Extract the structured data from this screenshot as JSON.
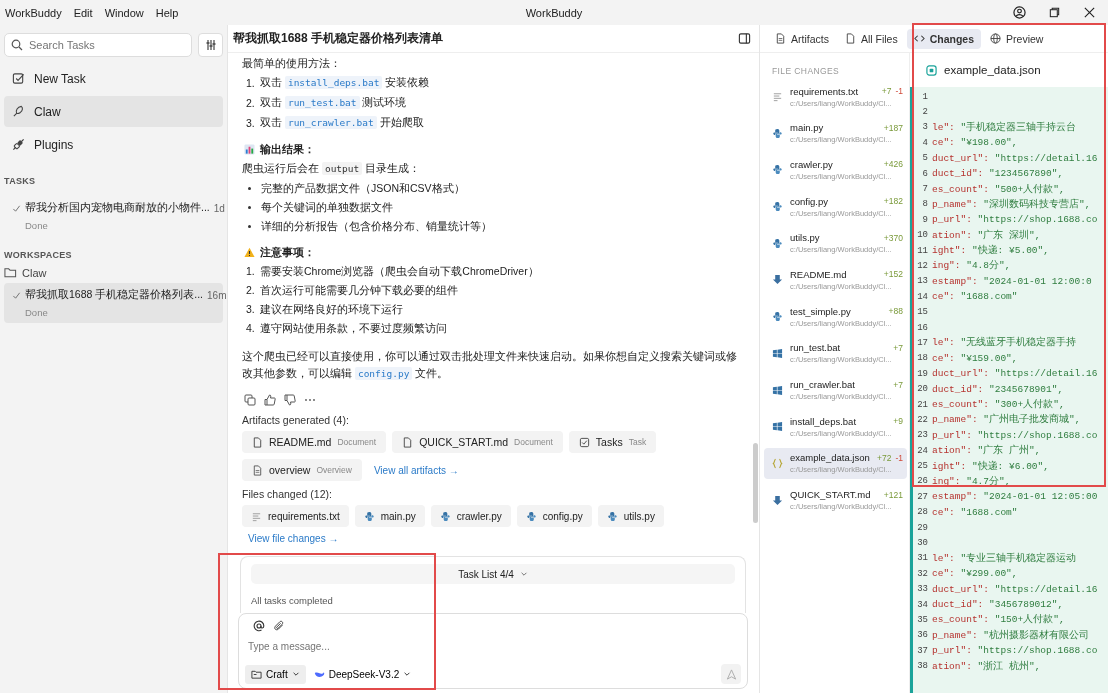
{
  "window": {
    "title": "WorkBuddy",
    "menu": [
      "WorkBuddy",
      "Edit",
      "Window",
      "Help"
    ]
  },
  "sidebar": {
    "search": {
      "placeholder": "Search Tasks"
    },
    "nav": [
      {
        "label": "New Task",
        "kind": "new",
        "selected": false
      },
      {
        "label": "Claw",
        "kind": "claw",
        "selected": true
      },
      {
        "label": "Plugins",
        "kind": "plugins",
        "selected": false
      }
    ],
    "tasks_heading": "TASKS",
    "tasks": [
      {
        "title": "帮我分析国内宠物电商耐放的小物件...",
        "time": "1d",
        "status": "Done",
        "selected": false
      }
    ],
    "workspaces_heading": "WORKSPACES",
    "workspace": {
      "name": "Claw",
      "tasks": [
        {
          "title": "帮我抓取1688 手机稳定器价格列表...",
          "time": "16m",
          "status": "Done",
          "selected": true
        }
      ]
    }
  },
  "chat": {
    "title": "帮我抓取1688 手机稳定器价格列表清单",
    "usage": {
      "intro": "最简单的使用方法：",
      "steps": [
        {
          "num": "1.",
          "segments": [
            {
              "text": "双击 "
            },
            {
              "code": "install_deps.bat"
            },
            {
              "text": " 安装依赖"
            }
          ]
        },
        {
          "num": "2.",
          "segments": [
            {
              "text": "双击 "
            },
            {
              "code": "run_test.bat"
            },
            {
              "text": " 测试环境"
            }
          ]
        },
        {
          "num": "3.",
          "segments": [
            {
              "text": "双击 "
            },
            {
              "code": "run_crawler.bat"
            },
            {
              "text": " 开始爬取"
            }
          ]
        }
      ]
    },
    "output": {
      "heading": "输出结果：",
      "intro": [
        {
          "text": "爬虫运行后会在 "
        },
        {
          "plain_code": "output"
        },
        {
          "text": " 目录生成："
        }
      ],
      "bullets": [
        "完整的产品数据文件（JSON和CSV格式）",
        "每个关键词的单独数据文件",
        "详细的分析报告（包含价格分布、销量统计等）"
      ]
    },
    "notes": {
      "heading": "注意事项：",
      "items": [
        {
          "num": "1.",
          "text": "需要安装Chrome浏览器（爬虫会自动下载ChromeDriver）"
        },
        {
          "num": "2.",
          "text": "首次运行可能需要几分钟下载必要的组件"
        },
        {
          "num": "3.",
          "text": "建议在网络良好的环境下运行"
        },
        {
          "num": "4.",
          "text": "遵守网站使用条款，不要过度频繁访问"
        }
      ]
    },
    "closing": [
      {
        "text": "这个爬虫已经可以直接使用，你可以通过双击批处理文件来快速启动。如果你想自定义搜索关键词或修改其他参数，可以编辑 "
      },
      {
        "code": "config.py"
      },
      {
        "text": " 文件。"
      }
    ],
    "artifacts_heading": "Artifacts generated (4):",
    "artifacts": [
      {
        "name": "README.md",
        "type": "Document",
        "kind": "doc"
      },
      {
        "name": "QUICK_START.md",
        "type": "Document",
        "kind": "doc"
      },
      {
        "name": "Tasks",
        "type": "Task",
        "kind": "task"
      },
      {
        "name": "overview",
        "type": "Overview",
        "kind": "overview"
      }
    ],
    "artifacts_link": "View all artifacts →",
    "files_heading": "Files changed (12):",
    "files": [
      {
        "name": "requirements.txt",
        "kind": "txt"
      },
      {
        "name": "main.py",
        "kind": "py"
      },
      {
        "name": "crawler.py",
        "kind": "py"
      },
      {
        "name": "config.py",
        "kind": "py"
      },
      {
        "name": "utils.py",
        "kind": "py"
      }
    ],
    "files_link": "View file changes →",
    "task_list": {
      "label": "Task List 4/4",
      "status": "All tasks completed"
    },
    "composer": {
      "placeholder": "Type a message...",
      "mode": "Craft",
      "model": "DeepSeek-V3.2",
      "send_disabled": true
    }
  },
  "panel": {
    "tabs": [
      {
        "label": "Artifacts",
        "kind": "artifacts",
        "selected": false
      },
      {
        "label": "All Files",
        "kind": "files",
        "selected": false
      },
      {
        "label": "Changes",
        "kind": "changes",
        "selected": true
      },
      {
        "label": "Preview",
        "kind": "preview",
        "selected": false
      }
    ],
    "changes_heading": "FILE CHANGES",
    "changes": [
      {
        "name": "requirements.txt",
        "kind": "txt",
        "added": "+7",
        "removed": "-1",
        "path": "c:/Users/liang/WorkBuddy/Cl...",
        "selected": false
      },
      {
        "name": "main.py",
        "kind": "py",
        "added": "+187",
        "path": "c:/Users/liang/WorkBuddy/Cl...",
        "selected": false
      },
      {
        "name": "crawler.py",
        "kind": "py",
        "added": "+426",
        "path": "c:/Users/liang/WorkBuddy/Cl...",
        "selected": false
      },
      {
        "name": "config.py",
        "kind": "py",
        "added": "+182",
        "path": "c:/Users/liang/WorkBuddy/Cl...",
        "selected": false
      },
      {
        "name": "utils.py",
        "kind": "py",
        "added": "+370",
        "path": "c:/Users/liang/WorkBuddy/Cl...",
        "selected": false
      },
      {
        "name": "README.md",
        "kind": "md",
        "added": "+152",
        "path": "c:/Users/liang/WorkBuddy/Cl...",
        "selected": false
      },
      {
        "name": "test_simple.py",
        "kind": "py",
        "added": "+88",
        "path": "c:/Users/liang/WorkBuddy/Cl...",
        "selected": false
      },
      {
        "name": "run_test.bat",
        "kind": "bat",
        "added": "+7",
        "path": "c:/Users/liang/WorkBuddy/Cl...",
        "selected": false
      },
      {
        "name": "run_crawler.bat",
        "kind": "bat",
        "added": "+7",
        "path": "c:/Users/liang/WorkBuddy/Cl...",
        "selected": false
      },
      {
        "name": "install_deps.bat",
        "kind": "bat",
        "added": "+9",
        "path": "c:/Users/liang/WorkBuddy/Cl...",
        "selected": false
      },
      {
        "name": "example_data.json",
        "kind": "json",
        "added": "+72",
        "removed": "-1",
        "path": "c:/Users/liang/WorkBuddy/Cl...",
        "selected": true
      },
      {
        "name": "QUICK_START.md",
        "kind": "md",
        "added": "+121",
        "path": "c:/Users/liang/WorkBuddy/Cl...",
        "selected": false
      }
    ],
    "file_title": "example_data.json",
    "code": [
      {
        "n": "1"
      },
      {
        "n": "2"
      },
      {
        "n": "3",
        "key": "le\":",
        "value": " \"手机稳定器三轴手持云台"
      },
      {
        "n": "4",
        "key": "ce\":",
        "value": " \"¥198.00\","
      },
      {
        "n": "5",
        "key": "duct_url\":",
        "value": " \"https://detail.16"
      },
      {
        "n": "6",
        "key": "duct_id\":",
        "value": " \"1234567890\","
      },
      {
        "n": "7",
        "key": "es_count\":",
        "value": " \"500+人付款\","
      },
      {
        "n": "8",
        "key": "p_name\":",
        "value": " \"深圳数码科技专营店\","
      },
      {
        "n": "9",
        "key": "p_url\":",
        "value": " \"https://shop.1688.co"
      },
      {
        "n": "10",
        "key": "ation\":",
        "value": " \"广东 深圳\","
      },
      {
        "n": "11",
        "key": "ight\":",
        "value": " \"快递: ¥5.00\","
      },
      {
        "n": "12",
        "key": "ing\":",
        "value": " \"4.8分\","
      },
      {
        "n": "13",
        "key": "estamp\":",
        "value": " \"2024-01-01 12:00:0"
      },
      {
        "n": "14",
        "key": "ce\":",
        "value": " \"1688.com\""
      },
      {
        "n": "15"
      },
      {
        "n": "16"
      },
      {
        "n": "17",
        "key": "le\":",
        "value": " \"无线蓝牙手机稳定器手持"
      },
      {
        "n": "18",
        "key": "ce\":",
        "value": " \"¥159.00\","
      },
      {
        "n": "19",
        "key": "duct_url\":",
        "value": " \"https://detail.16"
      },
      {
        "n": "20",
        "key": "duct_id\":",
        "value": " \"2345678901\","
      },
      {
        "n": "21",
        "key": "es_count\":",
        "value": " \"300+人付款\","
      },
      {
        "n": "22",
        "key": "p_name\":",
        "value": " \"广州电子批发商城\","
      },
      {
        "n": "23",
        "key": "p_url\":",
        "value": " \"https://shop.1688.co"
      },
      {
        "n": "24",
        "key": "ation\":",
        "value": " \"广东 广州\","
      },
      {
        "n": "25",
        "key": "ight\":",
        "value": " \"快递: ¥6.00\","
      },
      {
        "n": "26",
        "key": "ing\":",
        "value": " \"4.7分\","
      },
      {
        "n": "27",
        "key": "estamp\":",
        "value": " \"2024-01-01 12:05:00"
      },
      {
        "n": "28",
        "key": "ce\":",
        "value": " \"1688.com\""
      },
      {
        "n": "29"
      },
      {
        "n": "30"
      },
      {
        "n": "31",
        "key": "le\":",
        "value": " \"专业三轴手机稳定器运动"
      },
      {
        "n": "32",
        "key": "ce\":",
        "value": " \"¥299.00\","
      },
      {
        "n": "33",
        "key": "duct_url\":",
        "value": " \"https://detail.16"
      },
      {
        "n": "34",
        "key": "duct_id\":",
        "value": " \"3456789012\","
      },
      {
        "n": "35",
        "key": "es_count\":",
        "value": " \"150+人付款\","
      },
      {
        "n": "36",
        "key": "p_name\":",
        "value": " \"杭州摄影器材有限公司"
      },
      {
        "n": "37",
        "key": "p_url\":",
        "value": " \"https://shop.1688.co"
      },
      {
        "n": "38",
        "key": "ation\":",
        "value": " \"浙江 杭州\","
      }
    ]
  },
  "annotations": [
    {
      "kind": "red_box"
    },
    {
      "kind": "red_box"
    }
  ]
}
